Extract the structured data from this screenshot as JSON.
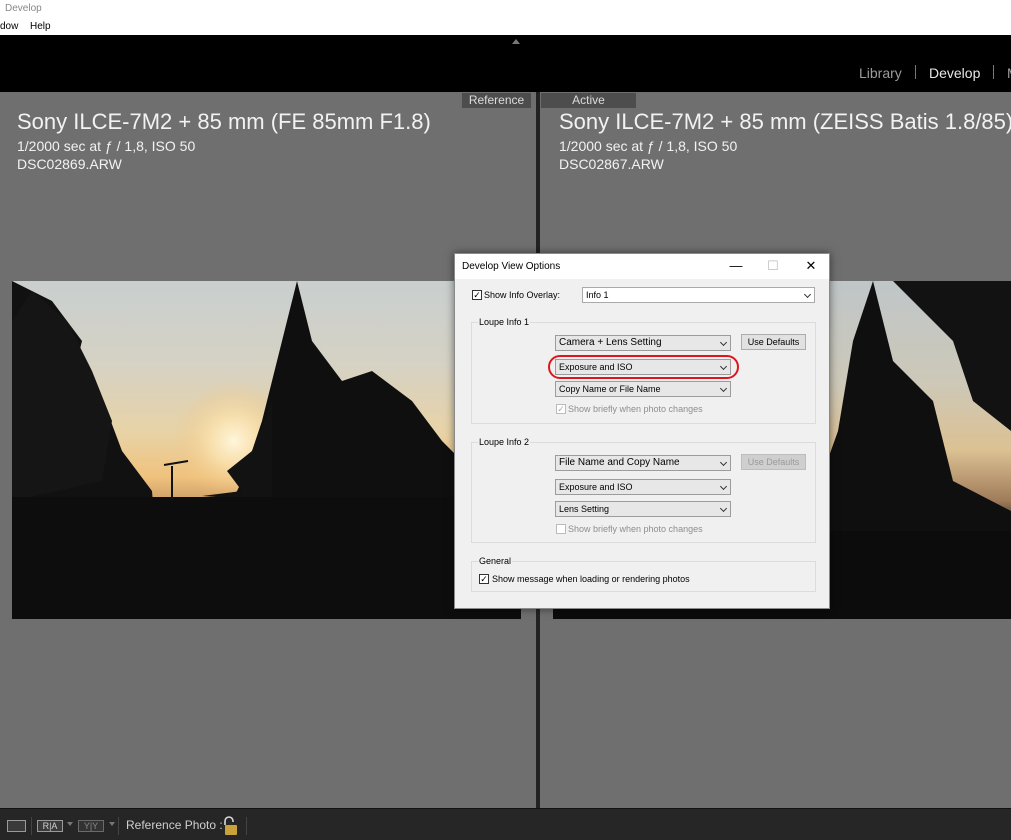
{
  "window": {
    "title": "Develop"
  },
  "menu": {
    "items": [
      "dow",
      "Help"
    ]
  },
  "modules": {
    "library": "Library",
    "develop": "Develop",
    "next": "M"
  },
  "reference_pane": {
    "label": "Reference",
    "camera_lens": "Sony ILCE-7M2 + 85 mm (FE 85mm F1.8)",
    "exposure": "1/2000 sec at ƒ / 1,8, ISO 50",
    "filename": "DSC02869.ARW"
  },
  "active_pane": {
    "label": "Active",
    "camera_lens": "Sony ILCE-7M2 + 85 mm (ZEISS Batis 1.8/85)",
    "exposure": "1/2000 sec at ƒ / 1,8, ISO 50",
    "filename": "DSC02867.ARW"
  },
  "toolbar": {
    "ra_label": "R|A",
    "yy_label": "Y|Y",
    "reference_photo_label": "Reference Photo :"
  },
  "dialog": {
    "title": "Develop View Options",
    "controls": {
      "minimize": "—",
      "maximize": "☐",
      "close": "✕"
    },
    "show_info_overlay": {
      "label": "Show Info Overlay:",
      "checked": true,
      "value": "Info 1"
    },
    "loupe1": {
      "title": "Loupe Info 1",
      "line1": "Camera + Lens Setting",
      "line2": "Exposure and ISO",
      "line3": "Copy Name or File Name",
      "use_defaults": "Use Defaults",
      "show_briefly": {
        "label": "Show briefly when photo changes",
        "checked": true,
        "disabled": true
      }
    },
    "loupe2": {
      "title": "Loupe Info 2",
      "line1": "File Name and Copy Name",
      "line2": "Exposure and ISO",
      "line3": "Lens Setting",
      "use_defaults": "Use Defaults",
      "show_briefly": {
        "label": "Show briefly when photo changes",
        "checked": false,
        "disabled": true
      }
    },
    "general": {
      "title": "General",
      "show_message": {
        "label": "Show message when loading or rendering photos",
        "checked": true
      }
    }
  },
  "colors": {
    "highlight": "#e0151b",
    "panel": "#6f6f6f",
    "modulebar": "#000000",
    "bottombar": "#262626"
  }
}
